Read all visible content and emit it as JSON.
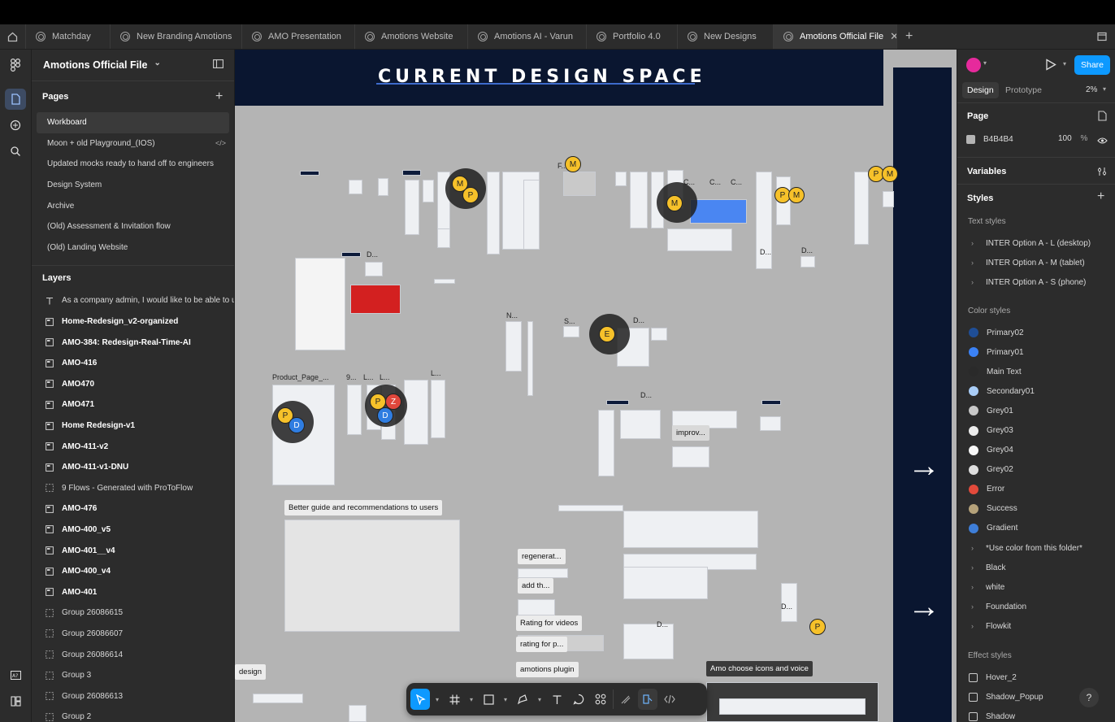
{
  "tabs": [
    {
      "label": "Matchday"
    },
    {
      "label": "New Branding Amotions"
    },
    {
      "label": "AMO Presentation"
    },
    {
      "label": "Amotions Website"
    },
    {
      "label": "Amotions AI - Varun"
    },
    {
      "label": "Portfolio 4.0"
    },
    {
      "label": "New Designs"
    },
    {
      "label": "Amotions Official File",
      "active": true,
      "close": "✕"
    }
  ],
  "add_tab": "+",
  "file": {
    "name": "Amotions Official File",
    "caret": "⌄"
  },
  "pages": {
    "title": "Pages",
    "add": "+",
    "items": [
      {
        "label": "Workboard",
        "selected": true
      },
      {
        "label": "Moon + old Playground_(IOS)",
        "icon": "</>"
      },
      {
        "label": "Updated mocks ready to hand off to engineers"
      },
      {
        "label": "Design System"
      },
      {
        "label": "Archive"
      },
      {
        "label": "(Old) Assessment & Invitation flow"
      },
      {
        "label": "(Old) Landing Website"
      }
    ]
  },
  "layers": {
    "title": "Layers",
    "items": [
      {
        "label": "As a company admin, I would like to be able to uplo",
        "icon": "text-icon",
        "bold": false
      },
      {
        "label": "Home-Redesign_v2-organized",
        "icon": "section-icon",
        "bold": true
      },
      {
        "label": "AMO-384: Redesign-Real-Time-AI",
        "icon": "section-icon",
        "bold": true
      },
      {
        "label": "AMO-416",
        "icon": "section-icon",
        "bold": true
      },
      {
        "label": "AMO470",
        "icon": "section-icon",
        "bold": true
      },
      {
        "label": "AMO471",
        "icon": "section-icon",
        "bold": true
      },
      {
        "label": "Home Redesign-v1",
        "icon": "section-icon",
        "bold": true
      },
      {
        "label": "AMO-411-v2",
        "icon": "section-icon",
        "bold": true
      },
      {
        "label": "AMO-411-v1-DNU",
        "icon": "section-icon",
        "bold": true
      },
      {
        "label": "9 Flows - Generated with ProToFlow",
        "icon": "group-icon",
        "bold": false
      },
      {
        "label": "AMO-476",
        "icon": "section-icon",
        "bold": true
      },
      {
        "label": "AMO-400_v5",
        "icon": "section-icon",
        "bold": true
      },
      {
        "label": "AMO-401__v4",
        "icon": "section-icon",
        "bold": true
      },
      {
        "label": "AMO-400_v4",
        "icon": "section-icon",
        "bold": true
      },
      {
        "label": "AMO-401",
        "icon": "section-icon",
        "bold": true
      },
      {
        "label": "Group 26086615",
        "icon": "group-icon",
        "bold": false
      },
      {
        "label": "Group 26086607",
        "icon": "group-icon",
        "bold": false
      },
      {
        "label": "Group 26086614",
        "icon": "group-icon",
        "bold": false
      },
      {
        "label": "Group 3",
        "icon": "group-icon",
        "bold": false
      },
      {
        "label": "Group 26086613",
        "icon": "group-icon",
        "bold": false
      },
      {
        "label": "Group 2",
        "icon": "group-icon",
        "bold": false
      }
    ]
  },
  "canvas": {
    "banner_title": "CURRENT DESIGN SPACE",
    "background": "#B4B4B4",
    "labels": [
      {
        "id": "product-page",
        "text": "Product_Page_..."
      },
      {
        "id": "l9",
        "text": "9..."
      },
      {
        "id": "lL1",
        "text": "L..."
      },
      {
        "id": "lL2",
        "text": "L..."
      },
      {
        "id": "lL3",
        "text": "L..."
      },
      {
        "id": "lN",
        "text": "N..."
      },
      {
        "id": "lS",
        "text": "S..."
      },
      {
        "id": "lD1",
        "text": "D..."
      },
      {
        "id": "lD2",
        "text": "D..."
      },
      {
        "id": "lF",
        "text": "F...6..."
      },
      {
        "id": "lC1",
        "text": "C..."
      },
      {
        "id": "lC2",
        "text": "C..."
      },
      {
        "id": "lC3",
        "text": "C..."
      },
      {
        "id": "lD3",
        "text": "D..."
      },
      {
        "id": "lD4",
        "text": "D..."
      },
      {
        "id": "lD5",
        "text": "D..."
      },
      {
        "id": "lD6",
        "text": "D..."
      },
      {
        "id": "lD7",
        "text": "D..."
      }
    ],
    "stickies": [
      {
        "id": "better-guide",
        "text": "Better guide and recommendations to users",
        "dark": false
      },
      {
        "id": "improv",
        "text": "improv...",
        "dark": false
      },
      {
        "id": "regenerat",
        "text": "regenerat...",
        "dark": false
      },
      {
        "id": "addth",
        "text": "add th...",
        "dark": false
      },
      {
        "id": "rating-videos",
        "text": "Rating for videos",
        "dark": false
      },
      {
        "id": "rating-p",
        "text": "rating for p...",
        "dark": false
      },
      {
        "id": "amotions-plugin",
        "text": "amotions plugin",
        "dark": false
      },
      {
        "id": "design",
        "text": "design",
        "dark": false
      },
      {
        "id": "amo-icons",
        "text": "Amo choose icons and voice",
        "dark": true
      }
    ],
    "cursors": [
      {
        "id": "c1",
        "avatars": [
          {
            "l": "M",
            "c": "y"
          },
          {
            "l": "P",
            "c": "y"
          }
        ]
      },
      {
        "id": "c2",
        "avatars": [
          {
            "l": "M",
            "c": "y"
          }
        ]
      },
      {
        "id": "c3",
        "avatars": [
          {
            "l": "M",
            "c": "y"
          }
        ]
      },
      {
        "id": "c4",
        "avatars": [
          {
            "l": "P",
            "c": "y"
          },
          {
            "l": "M",
            "c": "y"
          }
        ]
      },
      {
        "id": "c5",
        "avatars": [
          {
            "l": "P",
            "c": "y"
          },
          {
            "l": "M",
            "c": "y"
          }
        ]
      },
      {
        "id": "c6",
        "avatars": [
          {
            "l": "E",
            "c": "y"
          }
        ]
      },
      {
        "id": "c7",
        "avatars": [
          {
            "l": "P",
            "c": "y"
          },
          {
            "l": "Z",
            "c": "r"
          },
          {
            "l": "D",
            "c": "b"
          }
        ]
      },
      {
        "id": "c8",
        "avatars": [
          {
            "l": "P",
            "c": "y"
          },
          {
            "l": "D",
            "c": "b"
          }
        ]
      },
      {
        "id": "c9",
        "avatars": [
          {
            "l": "P",
            "c": "y"
          }
        ]
      }
    ],
    "arrows": [
      "→",
      "→"
    ]
  },
  "toolbar": {
    "tools": [
      "move-tool",
      "frame-tool",
      "shape-tool",
      "pen-tool",
      "text-tool",
      "comment-tool",
      "actions-tool",
      "draw-tool",
      "dev-mode-tool",
      "code-tool"
    ]
  },
  "right": {
    "tabs": {
      "design": "Design",
      "prototype": "Prototype"
    },
    "zoom": "2%",
    "share": "Share",
    "page": {
      "title": "Page",
      "color": "B4B4B4",
      "opacity": "100",
      "unit": "%"
    },
    "variables": "Variables",
    "styles": {
      "title": "Styles",
      "add": "+"
    },
    "text_styles": {
      "title": "Text styles",
      "items": [
        "INTER Option A - L (desktop)",
        "INTER Option A - M (tablet)",
        "INTER Option A - S (phone)"
      ]
    },
    "color_styles": {
      "title": "Color styles",
      "items": [
        {
          "label": "Primary02",
          "color": "#1f4e96",
          "type": "swatch"
        },
        {
          "label": "Primary01",
          "color": "#3b82f6",
          "type": "swatch"
        },
        {
          "label": "Main Text",
          "color": "#2a2a2a",
          "type": "swatch"
        },
        {
          "label": "Secondary01",
          "color": "#a9cdf7",
          "type": "swatch"
        },
        {
          "label": "Grey01",
          "color": "#c8c8c8",
          "type": "swatch"
        },
        {
          "label": "Grey03",
          "color": "#ececec",
          "type": "swatch"
        },
        {
          "label": "Grey04",
          "color": "#f7f7f7",
          "type": "swatch"
        },
        {
          "label": "Grey02",
          "color": "#dedede",
          "type": "swatch"
        },
        {
          "label": "Error",
          "color": "#e24a3b",
          "type": "swatch"
        },
        {
          "label": "Success",
          "color": "#b5a27a",
          "type": "swatch"
        },
        {
          "label": "Gradient",
          "color": "#3e7ed8",
          "type": "swatch"
        },
        {
          "label": "*Use color from this folder*",
          "type": "folder"
        },
        {
          "label": "Black",
          "type": "folder"
        },
        {
          "label": "white",
          "type": "folder"
        },
        {
          "label": "Foundation",
          "type": "folder"
        },
        {
          "label": "Flowkit",
          "type": "folder"
        }
      ]
    },
    "effect_styles": {
      "title": "Effect styles",
      "items": [
        "Hover_2",
        "Shadow_Popup",
        "Shadow"
      ]
    },
    "help": "?"
  }
}
